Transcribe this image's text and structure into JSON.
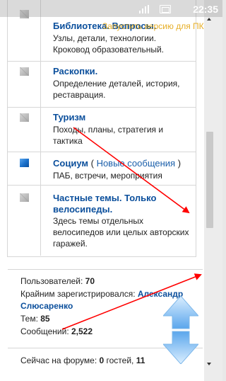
{
  "status_bar": {
    "time": "22:35"
  },
  "pc_version_link": "Запустить версию для ПК",
  "forums": [
    {
      "title": "Библиотека. Вопросы.",
      "desc_lines": [
        "Узлы, детали, технологии.",
        "Кроковод образовательный."
      ],
      "icon": "forum-read-icon"
    },
    {
      "title": "Раскопки.",
      "desc_lines": [
        "Определение деталей, история,",
        "реставрация."
      ],
      "icon": "forum-read-icon"
    },
    {
      "title": "Туризм",
      "desc_lines": [
        "Походы, планы, стратегия и",
        "тактика"
      ],
      "icon": "forum-read-icon"
    },
    {
      "title": "Социум",
      "new_prefix": " ( ",
      "new_link": "Новые сообщения",
      "new_suffix": " )",
      "desc_lines": [
        "ПАБ, встречи, мероприятия"
      ],
      "icon": "forum-new-icon"
    },
    {
      "title_lines": [
        "Частные темы. Только",
        "велосипеды."
      ],
      "desc_lines": [
        "Здесь темы отдельных",
        "велосипедов или целых авторских",
        "гаражей."
      ],
      "icon": "forum-read-icon"
    }
  ],
  "stats": {
    "users_label": "Пользователей: ",
    "users_value": "70",
    "last_registered_label": "Крайним зарегистрировался: ",
    "last_registered_first": "Александр",
    "last_registered_second": "Слюсаренко",
    "topics_label": "Тем: ",
    "topics_value": "85",
    "posts_label": "Сообщений: ",
    "posts_value": "2,522"
  },
  "online": {
    "label": "Сейчас на форуме: ",
    "guests_value": "0",
    "guests_label": " гостей, ",
    "members_value": "11"
  },
  "colors": {
    "link": "#0b4f9c",
    "arrow": "#ff0000",
    "pc_link": "#e2a000"
  }
}
